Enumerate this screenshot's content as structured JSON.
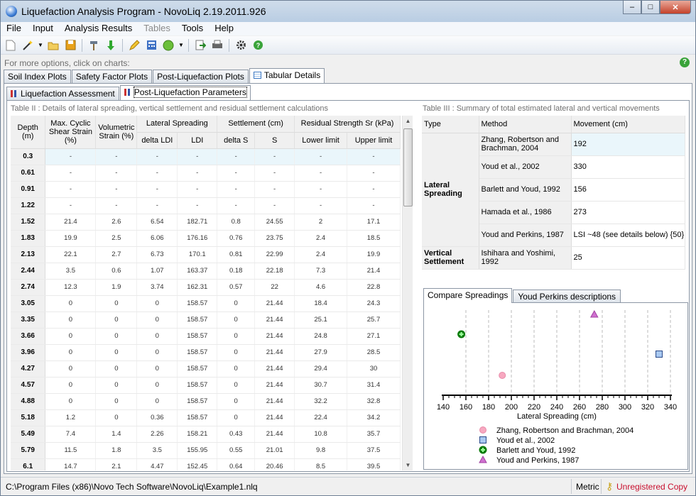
{
  "window": {
    "title": "Liquefaction Analysis Program - NovoLiq 2.19.2011.926",
    "minimize": "–",
    "maximize": "□",
    "close": "✕"
  },
  "menu": [
    "File",
    "Input",
    "Analysis Results",
    "Tables",
    "Tools",
    "Help"
  ],
  "hint": "For more options, click on charts:",
  "main_tabs": [
    "Soil Index Plots",
    "Safety Factor Plots",
    "Post-Liquefaction Plots",
    "Tabular Details"
  ],
  "sub_tabs": [
    "Liquefaction Assessment",
    "Post-Liquefaction Parameters"
  ],
  "table2": {
    "caption": "Table II : Details of lateral spreading, vertical settlement and residual settlement calculations",
    "headers": {
      "depth": "Depth (m)",
      "shear": "Max. Cyclic Shear Strain (%)",
      "vol": "Volumetric Strain (%)",
      "lat": "Lateral Spreading",
      "dldi": "delta LDI",
      "ldi": "LDI",
      "settle": "Settlement (cm)",
      "ds": "delta S",
      "s": "S",
      "resid": "Residual Strength Sr (kPa)",
      "low": "Lower limit",
      "up": "Upper limit"
    },
    "rows": [
      [
        "0.3",
        "-",
        "-",
        "-",
        "-",
        "-",
        "-",
        "-",
        "-"
      ],
      [
        "0.61",
        "-",
        "-",
        "-",
        "-",
        "-",
        "-",
        "-",
        "-"
      ],
      [
        "0.91",
        "-",
        "-",
        "-",
        "-",
        "-",
        "-",
        "-",
        "-"
      ],
      [
        "1.22",
        "-",
        "-",
        "-",
        "-",
        "-",
        "-",
        "-",
        "-"
      ],
      [
        "1.52",
        "21.4",
        "2.6",
        "6.54",
        "182.71",
        "0.8",
        "24.55",
        "2",
        "17.1"
      ],
      [
        "1.83",
        "19.9",
        "2.5",
        "6.06",
        "176.16",
        "0.76",
        "23.75",
        "2.4",
        "18.5"
      ],
      [
        "2.13",
        "22.1",
        "2.7",
        "6.73",
        "170.1",
        "0.81",
        "22.99",
        "2.4",
        "19.9"
      ],
      [
        "2.44",
        "3.5",
        "0.6",
        "1.07",
        "163.37",
        "0.18",
        "22.18",
        "7.3",
        "21.4"
      ],
      [
        "2.74",
        "12.3",
        "1.9",
        "3.74",
        "162.31",
        "0.57",
        "22",
        "4.6",
        "22.8"
      ],
      [
        "3.05",
        "0",
        "0",
        "0",
        "158.57",
        "0",
        "21.44",
        "18.4",
        "24.3"
      ],
      [
        "3.35",
        "0",
        "0",
        "0",
        "158.57",
        "0",
        "21.44",
        "25.1",
        "25.7"
      ],
      [
        "3.66",
        "0",
        "0",
        "0",
        "158.57",
        "0",
        "21.44",
        "24.8",
        "27.1"
      ],
      [
        "3.96",
        "0",
        "0",
        "0",
        "158.57",
        "0",
        "21.44",
        "27.9",
        "28.5"
      ],
      [
        "4.27",
        "0",
        "0",
        "0",
        "158.57",
        "0",
        "21.44",
        "29.4",
        "30"
      ],
      [
        "4.57",
        "0",
        "0",
        "0",
        "158.57",
        "0",
        "21.44",
        "30.7",
        "31.4"
      ],
      [
        "4.88",
        "0",
        "0",
        "0",
        "158.57",
        "0",
        "21.44",
        "32.2",
        "32.8"
      ],
      [
        "5.18",
        "1.2",
        "0",
        "0.36",
        "158.57",
        "0",
        "21.44",
        "22.4",
        "34.2"
      ],
      [
        "5.49",
        "7.4",
        "1.4",
        "2.26",
        "158.21",
        "0.43",
        "21.44",
        "10.8",
        "35.7"
      ],
      [
        "5.79",
        "11.5",
        "1.8",
        "3.5",
        "155.95",
        "0.55",
        "21.01",
        "9.8",
        "37.5"
      ],
      [
        "6.1",
        "14.7",
        "2.1",
        "4.47",
        "152.45",
        "0.64",
        "20.46",
        "8.5",
        "39.5"
      ]
    ]
  },
  "table3": {
    "caption": "Table III : Summary of total estimated lateral and vertical movements",
    "headers": [
      "Type",
      "Method",
      "Movement (cm)"
    ],
    "lateral": "Lateral Spreading",
    "vertical": "Vertical Settlement",
    "rows": [
      {
        "method": "Zhang, Robertson and Brachman, 2004",
        "value": "192"
      },
      {
        "method": "Youd et al., 2002",
        "value": "330"
      },
      {
        "method": "Barlett and Youd, 1992",
        "value": "156"
      },
      {
        "method": "Hamada et al., 1986",
        "value": "273"
      },
      {
        "method": "Youd and Perkins, 1987",
        "value": "LSI ~48 (see details below) {50}"
      },
      {
        "method": "Ishihara and Yoshimi, 1992",
        "value": "25"
      }
    ]
  },
  "chart_tabs": [
    "Compare Spreadings",
    "Youd  Perkins descriptions"
  ],
  "chart_data": {
    "type": "scatter",
    "xlabel": "Lateral Spreading (cm)",
    "xlim": [
      140,
      340
    ],
    "ticks": [
      "140",
      "160",
      "180",
      "200",
      "220",
      "240",
      "260",
      "280",
      "300",
      "320",
      "340"
    ],
    "series": [
      {
        "name": "Zhang, Robertson and Brachman, 2004",
        "x": 192,
        "marker": "circle",
        "color": "#f7a8c0"
      },
      {
        "name": "Youd et al., 2002",
        "x": 330,
        "marker": "square",
        "color": "#a8c8f0"
      },
      {
        "name": "Barlett and Youd, 1992",
        "x": 156,
        "marker": "cross",
        "color": "#2aa52a"
      },
      {
        "name": "Youd and Perkins, 1987",
        "x": 273,
        "marker": "triangle",
        "color": "#d070d0"
      }
    ]
  },
  "status": {
    "path": "C:\\Program Files (x86)\\Novo Tech Software\\NovoLiq\\Example1.nlq",
    "units": "Metric",
    "reg": "Unregistered Copy"
  }
}
